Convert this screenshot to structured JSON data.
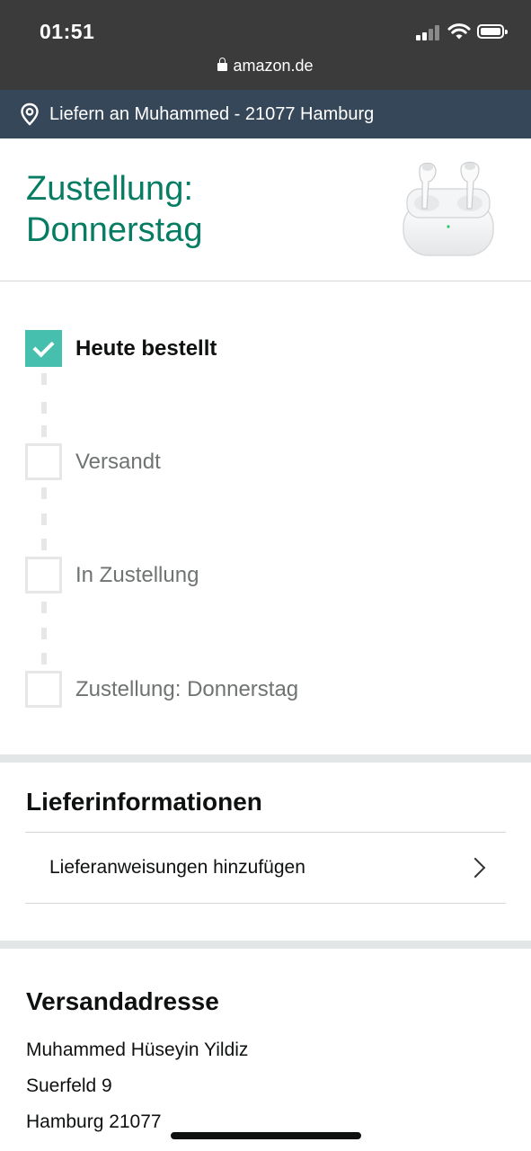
{
  "status_bar": {
    "time": "01:51",
    "url": "amazon.de"
  },
  "deliver_to": {
    "text": "Liefern an Muhammed - 21077 Hamburg"
  },
  "header": {
    "title": "Zustellung: Donnerstag"
  },
  "timeline": {
    "steps": [
      {
        "label": "Heute bestellt",
        "completed": true
      },
      {
        "label": "Versandt",
        "completed": false
      },
      {
        "label": "In Zustellung",
        "completed": false
      },
      {
        "label": "Zustellung: Donnerstag",
        "completed": false
      }
    ]
  },
  "delivery_info": {
    "title": "Lieferinformationen",
    "add_instructions_label": "Lieferanweisungen hinzufügen"
  },
  "shipping_address": {
    "title": "Versandadresse",
    "lines": [
      "Muhammed Hüseyin Yildiz",
      "Suerfeld 9",
      "Hamburg 21077"
    ]
  },
  "colors": {
    "accent_green": "#067d62",
    "check_teal": "#47bfae",
    "deliver_bar": "#37475a",
    "status_bar": "#3b3b3b"
  }
}
